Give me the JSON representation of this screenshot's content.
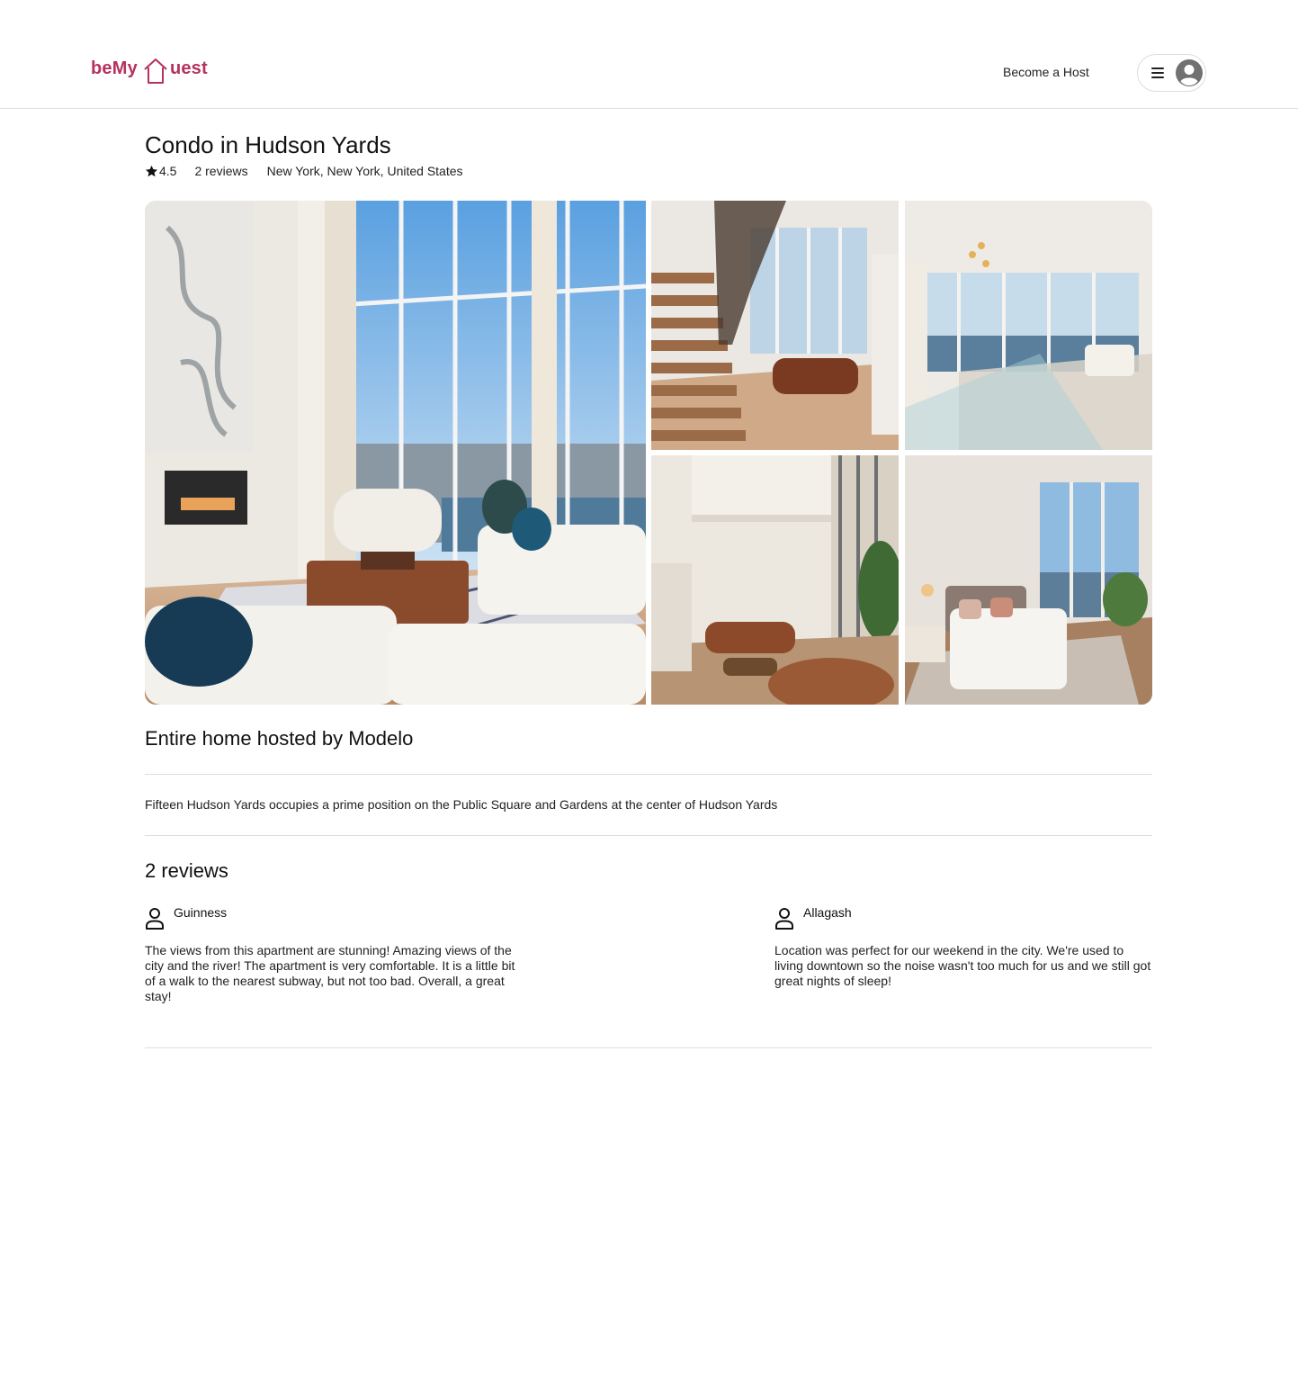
{
  "header": {
    "logo_part1": "beMy",
    "logo_part2": "uest",
    "become_host": "Become a Host",
    "brand_color": "#b5315f"
  },
  "listing": {
    "title": "Condo in Hudson Yards",
    "rating": "4.5",
    "reviews_count_label": "2 reviews",
    "location": "New York, New York, United States",
    "host_heading": "Entire home hosted by Modelo",
    "description": "Fifteen Hudson Yards occupies a prime position on the Public Square and Gardens at the center of Hudson Yards"
  },
  "gallery": {
    "photos": [
      {
        "subject": "living room with floor-to-ceiling windows"
      },
      {
        "subject": "floating staircase and lounge"
      },
      {
        "subject": "glass railing overlooking river"
      },
      {
        "subject": "double-height living area"
      },
      {
        "subject": "bedroom with river view"
      }
    ]
  },
  "reviews": {
    "heading": "2 reviews",
    "items": [
      {
        "name": "Guinness",
        "text": "The views from this apartment are stunning! Amazing views of the city and the river! The apartment is very comfortable. It is a little bit of a walk to the nearest subway, but not too bad. Overall, a great stay!"
      },
      {
        "name": "Allagash",
        "text": "Location was perfect for our weekend in the city. We're used to living downtown so the noise wasn't too much for us and we still got great nights of sleep!"
      }
    ]
  },
  "icons": {
    "logo": "house-outline-icon",
    "menu": "hamburger-icon",
    "avatar": "user-avatar-icon",
    "rating": "star-icon",
    "reviewer": "person-outline-icon"
  }
}
